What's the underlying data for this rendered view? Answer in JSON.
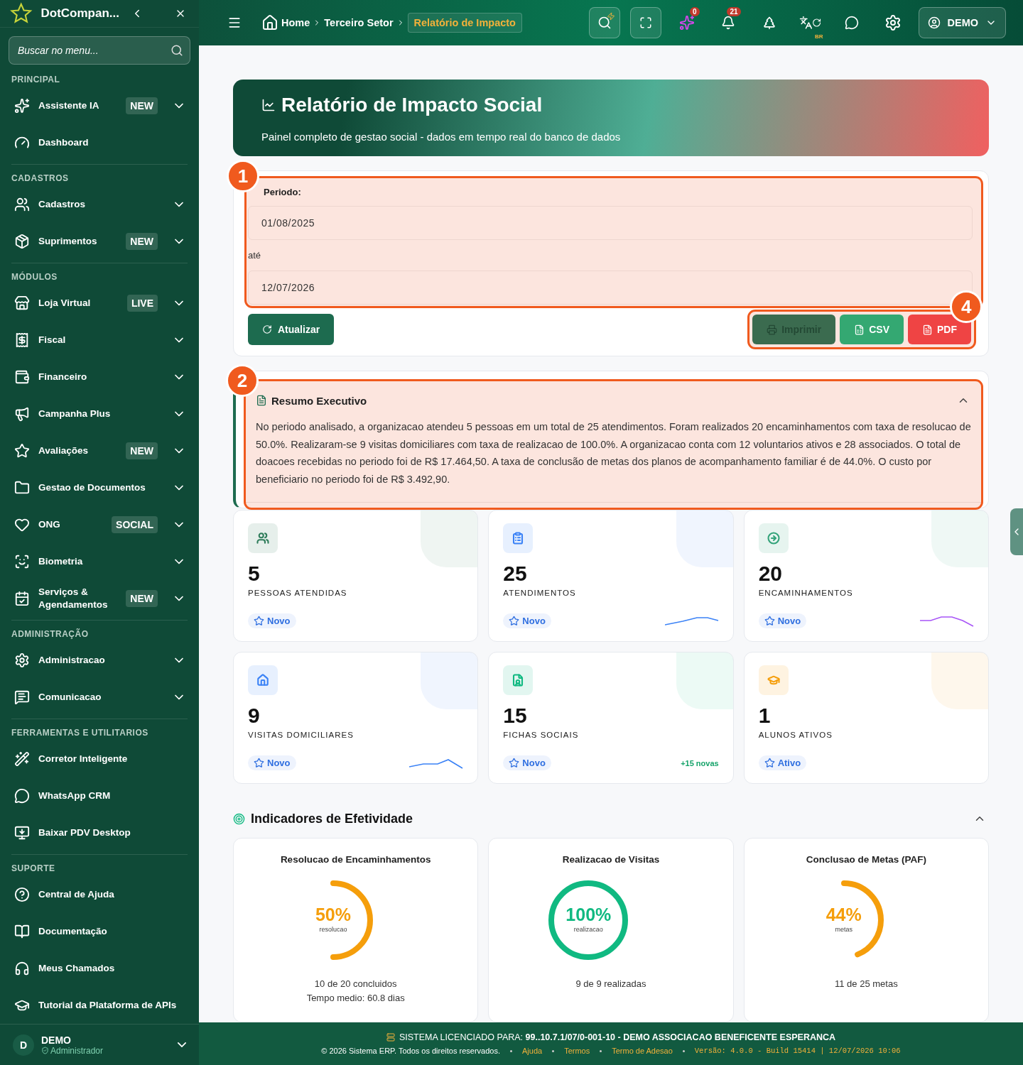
{
  "sidebar": {
    "brand": "DotCompan...",
    "search": {
      "placeholder": "Buscar no menu..."
    },
    "sections": [
      {
        "title": "PRINCIPAL",
        "items": [
          {
            "label": "Assistente IA",
            "badge": "NEW",
            "expandable": true
          },
          {
            "label": "Dashboard",
            "expandable": false
          }
        ]
      },
      {
        "title": "CADASTROS",
        "items": [
          {
            "label": "Cadastros",
            "expandable": true
          },
          {
            "label": "Suprimentos",
            "badge": "NEW",
            "expandable": true
          }
        ]
      },
      {
        "title": "MÓDULOS",
        "items": [
          {
            "label": "Loja Virtual",
            "badge": "LIVE",
            "expandable": true
          },
          {
            "label": "Fiscal",
            "expandable": true
          },
          {
            "label": "Financeiro",
            "expandable": true
          },
          {
            "label": "Campanha Plus",
            "expandable": true
          },
          {
            "label": "Avaliações",
            "badge": "NEW",
            "expandable": true
          },
          {
            "label": "Gestao de Documentos",
            "expandable": true
          },
          {
            "label": "ONG",
            "badge": "SOCIAL",
            "expandable": true
          },
          {
            "label": "Biometria",
            "expandable": true
          },
          {
            "label": "Serviços & Agendamentos",
            "badge": "NEW",
            "expandable": true
          }
        ]
      },
      {
        "title": "ADMINISTRAÇÃO",
        "items": [
          {
            "label": "Administracao",
            "expandable": true
          },
          {
            "label": "Comunicacao",
            "expandable": true
          }
        ]
      },
      {
        "title": "FERRAMENTAS E UTILITARIOS",
        "items": [
          {
            "label": "Corretor Inteligente",
            "expandable": false
          },
          {
            "label": "WhatsApp CRM",
            "expandable": false
          },
          {
            "label": "Baixar PDV Desktop",
            "expandable": false
          }
        ]
      },
      {
        "title": "SUPORTE",
        "items": [
          {
            "label": "Central de Ajuda",
            "expandable": false
          },
          {
            "label": "Documentação",
            "expandable": false
          },
          {
            "label": "Meus Chamados",
            "expandable": false
          },
          {
            "label": "Tutorial da Plataforma de APIs",
            "expandable": false
          }
        ]
      }
    ],
    "user": {
      "initial": "D",
      "name": "DEMO",
      "role": "Administrador"
    }
  },
  "topbar": {
    "breadcrumb": [
      {
        "label": "Home",
        "selected": false
      },
      {
        "label": "Terceiro Setor",
        "selected": false
      },
      {
        "label": "Relatório de Impacto",
        "selected": true
      }
    ],
    "ai_count": "0",
    "notification_count": "21",
    "language": "BR",
    "user": "DEMO"
  },
  "hero": {
    "title": "Relatório de Impacto Social",
    "subtitle": "Painel completo de gestao social - dados em tempo real do banco de dados"
  },
  "filters": {
    "annotation": "1",
    "label": "Periodo:",
    "start": "01/08/2025",
    "separator": "até",
    "end": "12/07/2026",
    "refresh": "Atualizar",
    "exports": {
      "annotation": "4",
      "buttons": [
        {
          "label": "Imprimir",
          "kind": "print",
          "disabled": true
        },
        {
          "label": "CSV",
          "kind": "csv",
          "disabled": false
        },
        {
          "label": "PDF",
          "kind": "pdf",
          "disabled": false
        }
      ]
    }
  },
  "summary": {
    "annotation": "2",
    "title": "Resumo Executivo",
    "expanded": true,
    "text": "No periodo analisado, a organizacao atendeu 5 pessoas em um total de 25 atendimentos. Foram realizados 20 encaminhamentos com taxa de resolucao de 50.0%. Realizaram-se 9 visitas domiciliares com taxa de realizacao de 100.0%. A organizacao conta com 12 voluntarios ativos e 28 associados. O total de doacoes recebidas no periodo foi de R$ 17.464,50. A taxa de conclusão de metas dos planos de acompanhamento familiar é de 44.0%. O custo por beneficiario no periodo foi de R$ 3.492,90."
  },
  "stats": [
    {
      "value": "5",
      "label": "PESSOAS ATENDIDAS",
      "tag": "Novo",
      "color": "#2f7d5b"
    },
    {
      "value": "25",
      "label": "ATENDIMENTOS",
      "tag": "Novo",
      "color": "#3b82f6",
      "trend": {
        "color": "#3b82f6"
      }
    },
    {
      "value": "20",
      "label": "ENCAMINHAMENTOS",
      "tag": "Novo",
      "color": "#34a37a",
      "trend": {
        "color": "#a855f7"
      }
    },
    {
      "value": "9",
      "label": "VISITAS DOMICILIARES",
      "tag": "Novo",
      "color": "#3b82f6",
      "trend": {
        "color": "#3b82f6"
      }
    },
    {
      "value": "15",
      "label": "FICHAS SOCIAIS",
      "tag": "Novo",
      "color": "#10b981",
      "note": "+15 novas"
    },
    {
      "value": "1",
      "label": "ALUNOS ATIVOS",
      "tag": "Ativo",
      "color": "#f59e0b"
    }
  ],
  "indicators": {
    "title": "Indicadores de Efetividade",
    "expanded": true,
    "gauges": [
      {
        "title": "Resolucao de Encaminhamentos",
        "reading": "50%",
        "caption": "resolucao",
        "level": 0.5,
        "color": "#f59e0b",
        "details": [
          "10 de 20 concluidos",
          "Tempo medio: 60.8 dias"
        ]
      },
      {
        "title": "Realizacao de Visitas",
        "reading": "100%",
        "caption": "realizacao",
        "level": 1,
        "color": "#10b981",
        "details": [
          "9 de 9 realizadas"
        ]
      },
      {
        "title": "Conclusao de Metas (PAF)",
        "reading": "44%",
        "caption": "metas",
        "level": 0.44,
        "color": "#f59e0b",
        "details": [
          "11 de 25 metas"
        ]
      }
    ]
  },
  "footer": {
    "license": "SISTEMA LICENCIADO PARA: **99..10.7.1/07/0-001-10 - DEMO ASSOCIACAO BENEFICENTE ESPERANCA**",
    "copyright": "© 2026 Sistema ERP. Todos os direitos reservados.",
    "links": [
      "Ajuda",
      "Termos",
      "Termo de Adesao"
    ],
    "version": "Versão: 4.0.0 - Build 15414 | 12/07/2026 10:06"
  }
}
